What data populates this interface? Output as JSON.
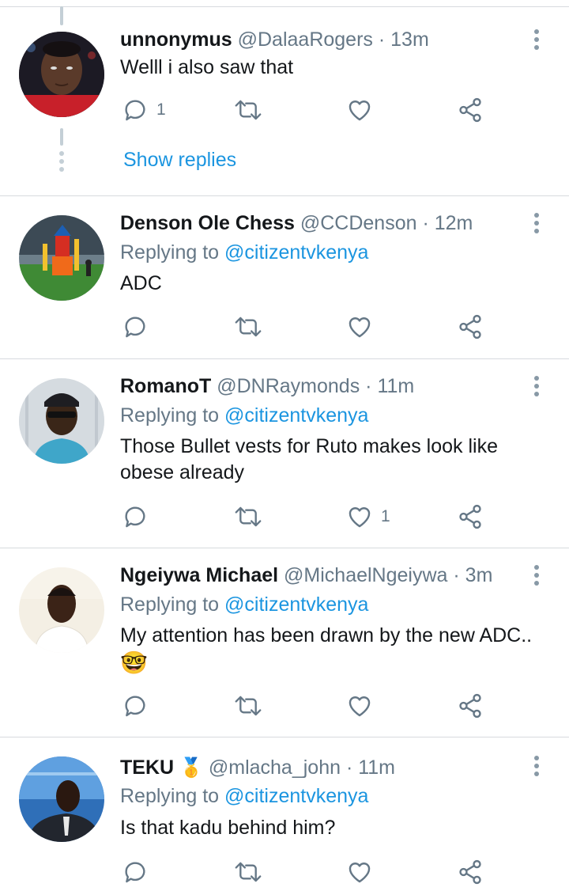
{
  "tweets": [
    {
      "name": "unnonymus",
      "handle": "@DalaaRogers",
      "separator": "·",
      "time": "13m",
      "text": "Welll i also saw that",
      "reply_count": "1",
      "like_count": "",
      "show_replies": "Show replies"
    },
    {
      "name": "Denson Ole Chess",
      "handle": "@CCDenson",
      "separator": "·",
      "time": "12m",
      "replying_prefix": "Replying to ",
      "replying_to": "@citizentvkenya",
      "text": "ADC"
    },
    {
      "name": "RomanoT",
      "handle": "@DNRaymonds",
      "separator": "·",
      "time": "11m",
      "replying_prefix": "Replying to ",
      "replying_to": "@citizentvkenya",
      "text": "Those Bullet vests for Ruto makes look like obese already",
      "like_count": "1"
    },
    {
      "name": "Ngeiywa Michael",
      "handle": "@MichaelNgeiywa",
      "separator": "·",
      "time": "3m",
      "replying_prefix": "Replying to ",
      "replying_to": "@citizentvkenya",
      "text": "My attention has been drawn by the new ADC..",
      "emoji": "🤓"
    },
    {
      "name": "TEKU",
      "name_badge": "🥇",
      "handle": "@mlacha_john",
      "separator": "·",
      "time": "11m",
      "replying_prefix": "Replying to ",
      "replying_to": "@citizentvkenya",
      "text": "Is that kadu behind him?"
    }
  ],
  "icons": {
    "reply": "reply-icon",
    "retweet": "retweet-icon",
    "like": "heart-icon",
    "share": "share-icon",
    "menu": "more-vertical-icon"
  },
  "colors": {
    "accent": "#1b95e0",
    "secondary_text": "#657786",
    "primary_text": "#14171a",
    "divider": "#d7dade"
  }
}
